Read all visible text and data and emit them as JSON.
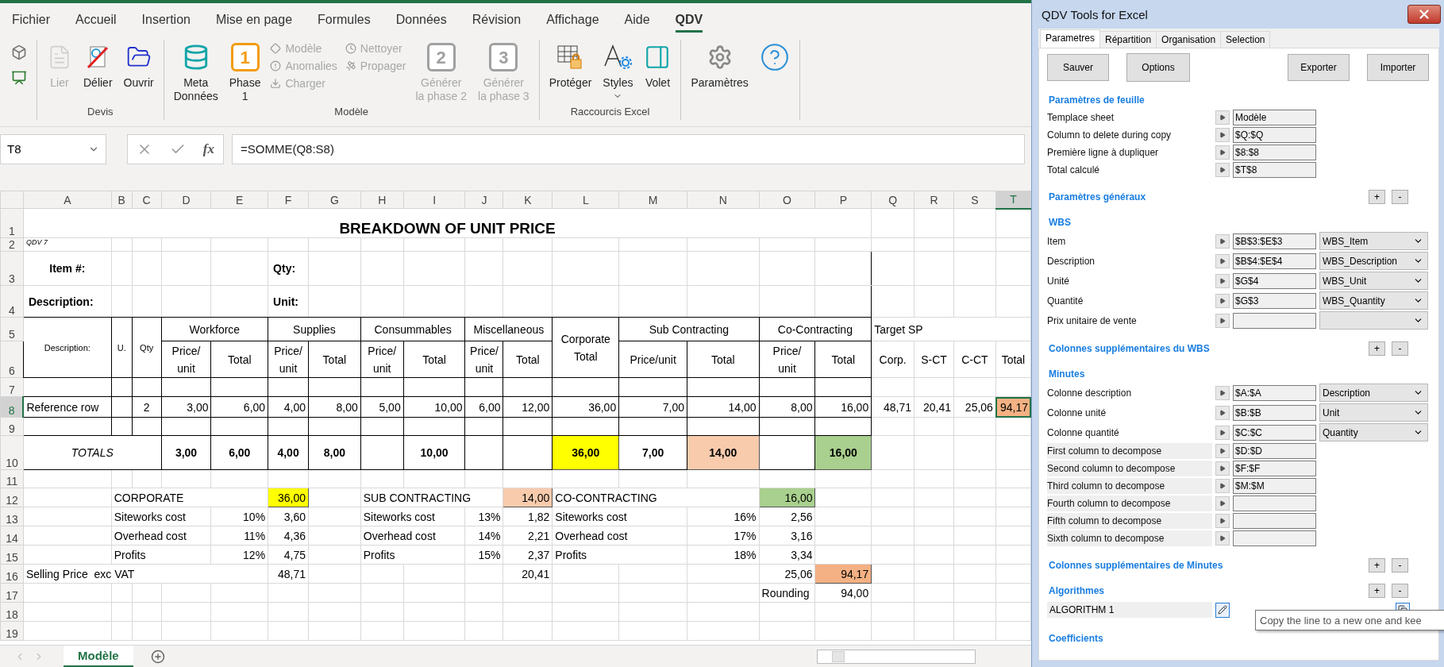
{
  "ribbon": {
    "tabs": [
      {
        "label": "Fichier",
        "selected": false
      },
      {
        "label": "Accueil",
        "selected": false
      },
      {
        "label": "Insertion",
        "selected": false
      },
      {
        "label": "Mise en page",
        "selected": false
      },
      {
        "label": "Formules",
        "selected": false
      },
      {
        "label": "Données",
        "selected": false
      },
      {
        "label": "Révision",
        "selected": false
      },
      {
        "label": "Affichage",
        "selected": false
      },
      {
        "label": "Aide",
        "selected": false
      },
      {
        "label": "QDV",
        "selected": true
      }
    ],
    "groups": [
      {
        "label": "Devis",
        "items": [
          {
            "kind": "large",
            "label": "Lier",
            "disabled": true,
            "dropdown": false
          },
          {
            "kind": "large",
            "label": "Délier",
            "disabled": false,
            "dropdown": false
          },
          {
            "kind": "large",
            "label": "Ouvrir",
            "disabled": false,
            "dropdown": false
          }
        ]
      },
      {
        "label": "Modèle",
        "items": [
          {
            "kind": "large",
            "label": "Meta\nDonnées",
            "disabled": false,
            "dropdown": false
          },
          {
            "kind": "badge",
            "label": "Phase\n1",
            "badge": "1",
            "disabled": false
          },
          {
            "kind": "stack",
            "items": [
              {
                "label": "Modèle",
                "disabled": true
              },
              {
                "label": "Anomalies",
                "disabled": true
              },
              {
                "label": "Charger",
                "disabled": true
              }
            ]
          },
          {
            "kind": "stack",
            "items": [
              {
                "label": "Nettoyer",
                "disabled": true
              },
              {
                "label": "Propager",
                "disabled": true
              }
            ]
          },
          {
            "kind": "badge",
            "label": "Générer\nla phase 2",
            "badge": "2",
            "disabled": true
          },
          {
            "kind": "badge",
            "label": "Générer\nla phase 3",
            "badge": "3",
            "disabled": true
          }
        ]
      },
      {
        "label": "Raccourcis Excel",
        "items": [
          {
            "kind": "large",
            "label": "Protéger",
            "disabled": false,
            "dropdown": false
          },
          {
            "kind": "large",
            "label": "Styles",
            "disabled": false,
            "dropdown": true
          },
          {
            "kind": "large",
            "label": "Volet",
            "disabled": false,
            "dropdown": false
          }
        ]
      },
      {
        "items": [
          {
            "kind": "large",
            "label": "Paramètres",
            "disabled": false,
            "dropdown": false
          },
          {
            "kind": "help"
          }
        ]
      }
    ]
  },
  "formula_bar": {
    "name_box": "T8",
    "function_label": "fx",
    "formula": "=SOMME(Q8:S8)"
  },
  "sheet": {
    "columns": [
      {
        "label": "A",
        "selected": false
      },
      {
        "label": "B",
        "selected": false
      },
      {
        "label": "C",
        "selected": false
      },
      {
        "label": "D",
        "selected": false
      },
      {
        "label": "E",
        "selected": false
      },
      {
        "label": "F",
        "selected": false
      },
      {
        "label": "G",
        "selected": false
      },
      {
        "label": "H",
        "selected": false
      },
      {
        "label": "I",
        "selected": false
      },
      {
        "label": "J",
        "selected": false
      },
      {
        "label": "K",
        "selected": false
      },
      {
        "label": "L",
        "selected": false
      },
      {
        "label": "M",
        "selected": false
      },
      {
        "label": "N",
        "selected": false
      },
      {
        "label": "O",
        "selected": false
      },
      {
        "label": "P",
        "selected": false
      },
      {
        "label": "Q",
        "selected": false
      },
      {
        "label": "R",
        "selected": false
      },
      {
        "label": "S",
        "selected": false
      },
      {
        "label": "T",
        "selected": true
      }
    ],
    "rows": [
      {
        "header": "1",
        "selected": false,
        "kind": "plain",
        "cells": {
          "A": {
            "text": "BREAKDOWN OF UNIT PRICE",
            "kind": "title"
          }
        }
      },
      {
        "header": "2",
        "selected": false,
        "kind": "plain",
        "cells": {
          "A": {
            "text": "QDV 7",
            "kind": "note"
          }
        }
      },
      {
        "header": "3",
        "selected": false,
        "kind": "boxtop",
        "cells": {
          "A": {
            "text": "Item #:",
            "kind": "bold-center"
          },
          "F": {
            "text": "Qty:",
            "kind": "bold"
          }
        }
      },
      {
        "header": "4",
        "selected": false,
        "kind": "boxbottom",
        "cells": {
          "A": {
            "text": "Description:",
            "kind": "bold"
          },
          "F": {
            "text": "Unit:",
            "kind": "bold"
          }
        }
      },
      {
        "header": "5",
        "selected": false,
        "kind": "grid",
        "cells": {
          "A": {
            "text": "Description:",
            "kind": "small-center",
            "down": true
          },
          "B": {
            "text": "U.",
            "kind": "small-center",
            "down": true
          },
          "C": {
            "text": "Qty",
            "kind": "small-center",
            "down": true
          },
          "D": {
            "text": "Workforce",
            "kind": "center"
          },
          "E": {
            "merged": true
          },
          "F": {
            "text": "Supplies",
            "kind": "center"
          },
          "G": {
            "merged": true
          },
          "H": {
            "text": "Consummables",
            "kind": "center"
          },
          "I": {
            "merged": true
          },
          "J": {
            "text": "Miscellaneous",
            "kind": "center"
          },
          "K": {
            "merged": true
          },
          "L": {
            "text": "Corporate Total",
            "kind": "wrap-center",
            "down": true
          },
          "M": {
            "text": "Sub Contracting",
            "kind": "center"
          },
          "N": {
            "merged": true
          },
          "O": {
            "text": "Co-Contracting",
            "kind": "center"
          },
          "P": {
            "merged": true
          },
          "Q": {
            "text": "Target SP",
            "kind": "label"
          }
        }
      },
      {
        "header": "6",
        "selected": false,
        "kind": "grid",
        "cells": {
          "D": {
            "text": "Price/ unit",
            "kind": "wrap-center"
          },
          "E": {
            "text": "Total",
            "kind": "center"
          },
          "F": {
            "text": "Price/ unit",
            "kind": "wrap-center"
          },
          "G": {
            "text": "Total",
            "kind": "center"
          },
          "H": {
            "text": "Price/ unit",
            "kind": "wrap-center"
          },
          "I": {
            "text": "Total",
            "kind": "center"
          },
          "J": {
            "text": "Price/ unit",
            "kind": "wrap-center"
          },
          "K": {
            "text": "Total",
            "kind": "center"
          },
          "M": {
            "text": "Price/unit",
            "kind": "center"
          },
          "N": {
            "text": "Total",
            "kind": "center"
          },
          "O": {
            "text": "Price/ unit",
            "kind": "wrap-center"
          },
          "P": {
            "text": "Total",
            "kind": "center"
          },
          "Q": {
            "text": "Corp.",
            "kind": "center"
          },
          "R": {
            "text": "S-CT",
            "kind": "center"
          },
          "S": {
            "text": "C-CT",
            "kind": "center"
          },
          "T": {
            "text": "Total",
            "kind": "center"
          }
        }
      },
      {
        "header": "7",
        "selected": false,
        "kind": "grid",
        "cells": {}
      },
      {
        "header": "8",
        "selected": true,
        "kind": "grid",
        "cells": {
          "A": {
            "text": "Reference row",
            "kind": "label"
          },
          "C": {
            "text": "2",
            "kind": "center"
          },
          "D": {
            "text": "3,00",
            "kind": "number"
          },
          "E": {
            "text": "6,00",
            "kind": "number"
          },
          "F": {
            "text": "4,00",
            "kind": "number"
          },
          "G": {
            "text": "8,00",
            "kind": "number"
          },
          "H": {
            "text": "5,00",
            "kind": "number"
          },
          "I": {
            "text": "10,00",
            "kind": "number"
          },
          "J": {
            "text": "6,00",
            "kind": "number"
          },
          "K": {
            "text": "12,00",
            "kind": "number"
          },
          "L": {
            "text": "36,00",
            "kind": "number"
          },
          "M": {
            "text": "7,00",
            "kind": "number"
          },
          "N": {
            "text": "14,00",
            "kind": "number"
          },
          "O": {
            "text": "8,00",
            "kind": "number"
          },
          "P": {
            "text": "16,00",
            "kind": "number"
          },
          "Q": {
            "text": "48,71",
            "kind": "number"
          },
          "R": {
            "text": "20,41",
            "kind": "number"
          },
          "S": {
            "text": "25,06",
            "kind": "number"
          },
          "T": {
            "text": "94,17",
            "kind": "number",
            "color": "#f4b183"
          }
        }
      },
      {
        "header": "9",
        "selected": false,
        "kind": "grid",
        "cells": {}
      },
      {
        "header": "10",
        "selected": false,
        "kind": "grid",
        "cells": {
          "A": {
            "text": "TOTALS",
            "kind": "italic-center"
          },
          "B": {
            "merged": true
          },
          "C": {
            "merged": true
          },
          "D": {
            "text": "3,00",
            "kind": "bold-center"
          },
          "E": {
            "text": "6,00",
            "kind": "bold-center"
          },
          "F": {
            "text": "4,00",
            "kind": "bold-center"
          },
          "G": {
            "text": "8,00",
            "kind": "bold-center"
          },
          "I": {
            "text": "10,00",
            "kind": "bold-center"
          },
          "L": {
            "text": "36,00",
            "kind": "bold-center",
            "color": "#ffff00"
          },
          "M": {
            "text": "7,00",
            "kind": "bold-center"
          },
          "N": {
            "text": "14,00",
            "kind": "bold-center",
            "color": "#f8cbad"
          },
          "P": {
            "text": "16,00",
            "kind": "bold-center",
            "color": "#a9d08e"
          }
        }
      },
      {
        "header": "11",
        "selected": false,
        "kind": "plain",
        "cells": {}
      },
      {
        "header": "12",
        "selected": false,
        "kind": "plain",
        "cells": {
          "B": {
            "text": "CORPORATE",
            "kind": "label"
          },
          "F": {
            "text": "36,00",
            "kind": "number",
            "color": "#ffff00"
          },
          "H": {
            "text": "SUB CONTRACTING",
            "kind": "label"
          },
          "K": {
            "text": "14,00",
            "kind": "number",
            "color": "#f8cbad"
          },
          "L": {
            "text": "CO-CONTRACTING",
            "kind": "label"
          },
          "O": {
            "text": "16,00",
            "kind": "number",
            "color": "#a9d08e"
          }
        }
      },
      {
        "header": "13",
        "selected": false,
        "kind": "plain",
        "cells": {
          "B": {
            "text": "Siteworks cost",
            "kind": "label"
          },
          "E": {
            "text": "10%",
            "kind": "number"
          },
          "F": {
            "text": "3,60",
            "kind": "number"
          },
          "H": {
            "text": "Siteworks cost",
            "kind": "label"
          },
          "J": {
            "text": "13%",
            "kind": "number"
          },
          "K": {
            "text": "1,82",
            "kind": "number"
          },
          "L": {
            "text": "Siteworks cost",
            "kind": "label"
          },
          "N": {
            "text": "16%",
            "kind": "number"
          },
          "O": {
            "text": "2,56",
            "kind": "number"
          }
        }
      },
      {
        "header": "14",
        "selected": false,
        "kind": "plain",
        "cells": {
          "B": {
            "text": "Overhead cost",
            "kind": "label"
          },
          "E": {
            "text": "11%",
            "kind": "number"
          },
          "F": {
            "text": "4,36",
            "kind": "number"
          },
          "H": {
            "text": "Overhead cost",
            "kind": "label"
          },
          "J": {
            "text": "14%",
            "kind": "number"
          },
          "K": {
            "text": "2,21",
            "kind": "number"
          },
          "L": {
            "text": "Overhead cost",
            "kind": "label"
          },
          "N": {
            "text": "17%",
            "kind": "number"
          },
          "O": {
            "text": "3,16",
            "kind": "number"
          }
        }
      },
      {
        "header": "15",
        "selected": false,
        "kind": "plain",
        "cells": {
          "B": {
            "text": "Profits",
            "kind": "label"
          },
          "E": {
            "text": "12%",
            "kind": "number"
          },
          "F": {
            "text": "4,75",
            "kind": "number"
          },
          "H": {
            "text": "Profits",
            "kind": "label"
          },
          "J": {
            "text": "15%",
            "kind": "number"
          },
          "K": {
            "text": "2,37",
            "kind": "number"
          },
          "L": {
            "text": "Profits",
            "kind": "label"
          },
          "N": {
            "text": "18%",
            "kind": "number"
          },
          "O": {
            "text": "3,34",
            "kind": "number"
          }
        }
      },
      {
        "header": "16",
        "selected": false,
        "kind": "plain",
        "cells": {
          "A": {
            "text": "Selling Price  exc VAT",
            "kind": "label"
          },
          "F": {
            "text": "48,71",
            "kind": "number"
          },
          "K": {
            "text": "20,41",
            "kind": "number"
          },
          "O": {
            "text": "25,06",
            "kind": "number"
          },
          "P": {
            "text": "94,17",
            "kind": "number",
            "color": "#f4b183"
          }
        }
      },
      {
        "header": "17",
        "selected": false,
        "kind": "plain",
        "cells": {
          "O": {
            "text": "Rounding",
            "kind": "label"
          },
          "P": {
            "text": "94,00",
            "kind": "number"
          }
        }
      },
      {
        "header": "18",
        "selected": false,
        "kind": "plain",
        "cells": {}
      },
      {
        "header": "19",
        "selected": false,
        "kind": "plain",
        "cells": {}
      }
    ]
  },
  "sheet_tabs": [
    {
      "label": "Modèle",
      "selected": true
    }
  ],
  "panel": {
    "title": "QDV Tools for Excel",
    "tabs": [
      {
        "label": "Parametres",
        "selected": true
      },
      {
        "label": "Répartition",
        "selected": false
      },
      {
        "label": "Organisation",
        "selected": false
      },
      {
        "label": "Selection",
        "selected": false
      }
    ],
    "buttons_left": [
      "Sauver",
      "Options"
    ],
    "buttons_right": [
      "Exporter",
      "Importer"
    ],
    "sections": [
      {
        "title": "Paramètres de feuille",
        "rows": [
          {
            "kind": "field",
            "label": "Templace sheet",
            "value": "Modèle",
            "shaded": false
          },
          {
            "kind": "field",
            "label": "Column to delete during copy",
            "value": "$Q:$Q",
            "shaded": false
          },
          {
            "kind": "field",
            "label": "Première ligne à dupliquer",
            "value": "$8:$8",
            "shaded": false
          },
          {
            "kind": "field",
            "label": "Total calculé",
            "value": "$T$8",
            "shaded": false
          }
        ]
      },
      {
        "title": "Paramètres généraux",
        "controls": [
          "+",
          "-"
        ]
      },
      {
        "title": "WBS",
        "rows": [
          {
            "kind": "select",
            "label": "Item",
            "value": "$B$3:$E$3",
            "dropdown": "WBS_Item",
            "shaded": false
          },
          {
            "kind": "select",
            "label": "Description",
            "value": "$B$4:$E$4",
            "dropdown": "WBS_Description",
            "shaded": false
          },
          {
            "kind": "select",
            "label": "Unité",
            "value": "$G$4",
            "dropdown": "WBS_Unit",
            "shaded": false
          },
          {
            "kind": "select",
            "label": "Quantité",
            "value": "$G$3",
            "dropdown": "WBS_Quantity",
            "shaded": false
          },
          {
            "kind": "select",
            "label": "Prix unitaire de vente",
            "shaded": false
          }
        ]
      },
      {
        "title": "Colonnes supplémentaires du WBS",
        "controls": [
          "+",
          "-"
        ]
      },
      {
        "title": "Minutes",
        "rows": [
          {
            "kind": "select",
            "label": "Colonne description",
            "value": "$A:$A",
            "dropdown": "Description",
            "shaded": false
          },
          {
            "kind": "select",
            "label": "Colonne unité",
            "value": "$B:$B",
            "dropdown": "Unit",
            "shaded": false
          },
          {
            "kind": "select",
            "label": "Colonne quantité",
            "value": "$C:$C",
            "dropdown": "Quantity",
            "shaded": false
          },
          {
            "kind": "field",
            "label": "First column to decompose",
            "value": "$D:$D",
            "shaded": true
          },
          {
            "kind": "field",
            "label": "Second column to decompose",
            "value": "$F:$F",
            "shaded": true
          },
          {
            "kind": "field",
            "label": "Third column to decompose",
            "value": "$M:$M",
            "shaded": true
          },
          {
            "kind": "field",
            "label": "Fourth column to decompose",
            "shaded": true
          },
          {
            "kind": "field",
            "label": "Fifth column to decompose",
            "shaded": true
          },
          {
            "kind": "field",
            "label": "Sixth column to decompose",
            "shaded": true
          }
        ]
      },
      {
        "title": "Colonnes supplémentaires de Minutes",
        "controls": [
          "+",
          "-"
        ]
      },
      {
        "title": "Algorithmes",
        "controls": [
          "+",
          "-"
        ],
        "rows": [
          {
            "kind": "algorithm",
            "label": "ALGORITHM 1",
            "shaded": true
          }
        ]
      },
      {
        "title": "Coefficients"
      }
    ],
    "tooltip": "Copy the line to a new one and kee"
  }
}
